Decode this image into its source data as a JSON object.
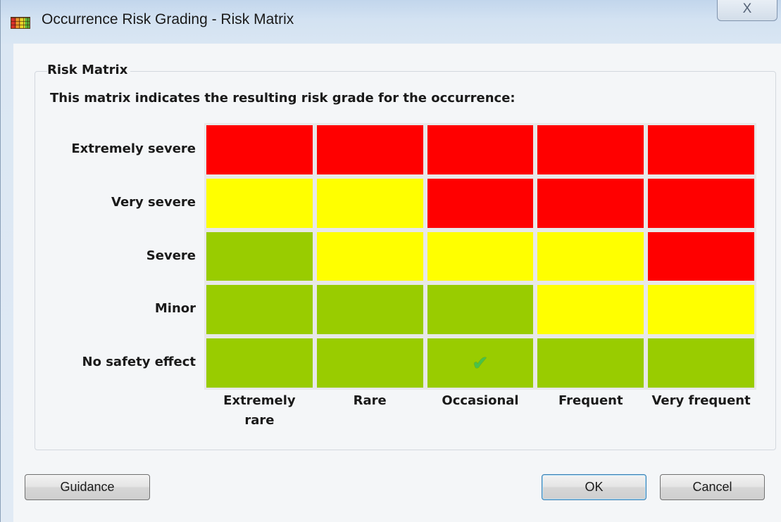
{
  "window": {
    "title": "Occurrence Risk Grading - Risk Matrix",
    "close_glyph": "X"
  },
  "group": {
    "legend": "Risk Matrix",
    "description": "This matrix indicates the resulting risk grade for the occurrence:"
  },
  "matrix": {
    "severity_labels": [
      "Extremely severe",
      "Very severe",
      "Severe",
      "Minor",
      "No safety effect"
    ],
    "likelihood_labels": [
      "Extremely rare",
      "Rare",
      "Occasional",
      "Frequent",
      "Very frequent"
    ],
    "colors": {
      "red": "#ff0000",
      "yellow": "#ffff00",
      "green": "#99cc00"
    },
    "grid": [
      [
        "red",
        "red",
        "red",
        "red",
        "red"
      ],
      [
        "yellow",
        "yellow",
        "red",
        "red",
        "red"
      ],
      [
        "green",
        "yellow",
        "yellow",
        "yellow",
        "red"
      ],
      [
        "green",
        "green",
        "green",
        "yellow",
        "yellow"
      ],
      [
        "green",
        "green",
        "green",
        "green",
        "green"
      ]
    ],
    "selected": {
      "severity": "No safety effect",
      "likelihood": "Occasional"
    },
    "selected_icon": "checkmark-icon"
  },
  "buttons": {
    "guidance": "Guidance",
    "ok": "OK",
    "cancel": "Cancel"
  }
}
